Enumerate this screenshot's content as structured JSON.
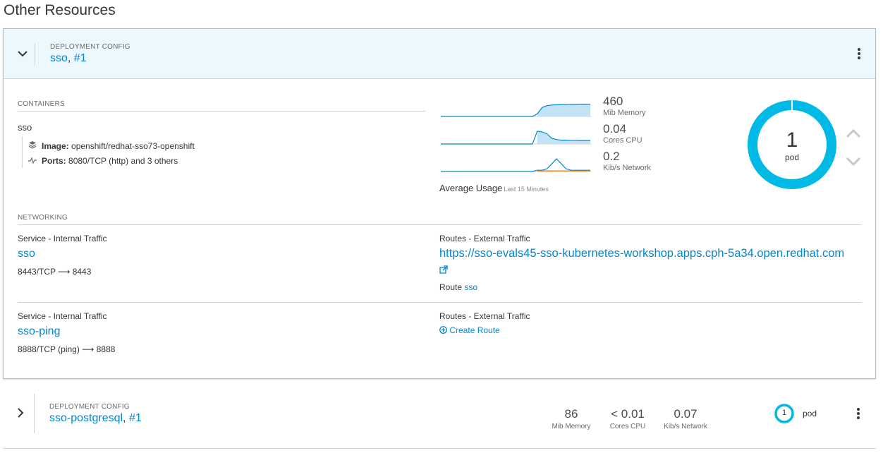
{
  "page": {
    "title": "Other Resources"
  },
  "resource1": {
    "kind": "Deployment Config",
    "name": "sso",
    "revision": "#1",
    "containers_title": "Containers",
    "container": {
      "name": "sso",
      "image_label": "Image:",
      "image_value": "openshift/redhat-sso73-openshift",
      "ports_label": "Ports:",
      "ports_value": "8080/TCP (http) and 3 others"
    },
    "metrics": [
      {
        "value": "460",
        "unit": "Mib Memory"
      },
      {
        "value": "0.04",
        "unit": "Cores CPU"
      },
      {
        "value": "0.2",
        "unit": "Kib/s Network"
      }
    ],
    "average_usage": "Average Usage",
    "average_period": "Last 15 Minutes",
    "pods": {
      "count": "1",
      "label": "pod"
    },
    "networking_title": "Networking",
    "services": [
      {
        "service_label": "Service - Internal Traffic",
        "service_name": "sso",
        "ports": "8443/TCP",
        "target": "8443",
        "routes_label": "Routes - External Traffic",
        "route_url": "https://sso-evals45-sso-kubernetes-workshop.apps.cph-5a34.open.redhat.com",
        "route_prefix": "Route",
        "route_name": "sso"
      },
      {
        "service_label": "Service - Internal Traffic",
        "service_name": "sso-ping",
        "ports": "8888/TCP (ping)",
        "target": "8888",
        "routes_label": "Routes - External Traffic",
        "create_route": "Create Route"
      }
    ]
  },
  "resource2": {
    "kind": "Deployment Config",
    "name": "sso-postgresql",
    "revision": "#1",
    "metrics": [
      {
        "value": "86",
        "unit": "Mib Memory"
      },
      {
        "value": "< 0.01",
        "unit": "Cores CPU"
      },
      {
        "value": "0.07",
        "unit": "Kib/s Network"
      }
    ],
    "pods": {
      "count": "1",
      "label": "pod"
    }
  },
  "colors": {
    "link": "#0088ce",
    "donut": "#00b9e4",
    "header_bg": "#edf8fe",
    "sparkline": "#0088ce",
    "sparkline_fill": "#c3e3f4",
    "network_alt": "#ec7a08"
  },
  "icons": [
    "chevron-down-icon",
    "chevron-right-icon",
    "kebab-icon",
    "layers-icon",
    "pulse-icon",
    "external-link-icon",
    "plus-circle-icon",
    "chevron-up-icon"
  ],
  "sparklines": {
    "memory": [
      0,
      0,
      0,
      0,
      0,
      0,
      0,
      0,
      0,
      0,
      0,
      0,
      0,
      0,
      0,
      0,
      0,
      0,
      0,
      0,
      0.2,
      0.7,
      0.85,
      0.9,
      0.92,
      0.93,
      0.94,
      0.95,
      0.95,
      0.96,
      0.96,
      0.96
    ],
    "cpu": [
      0,
      0,
      0,
      0,
      0,
      0,
      0,
      0,
      0,
      0,
      0,
      0,
      0,
      0,
      0,
      0,
      0,
      0,
      0,
      0,
      1.0,
      0.95,
      0.8,
      0.45,
      0.35,
      0.3,
      0.3,
      0.28,
      0.28,
      0.27,
      0.27,
      0.27
    ],
    "network_in": [
      0,
      0,
      0,
      0,
      0,
      0,
      0,
      0,
      0,
      0,
      0,
      0,
      0,
      0,
      0,
      0,
      0,
      0,
      0,
      0,
      0.1,
      0.1,
      0.2,
      0.6,
      1.0,
      0.6,
      0.2,
      0.1,
      0.1,
      0.1,
      0.1,
      0.1
    ],
    "network_out": [
      0,
      0,
      0,
      0,
      0,
      0,
      0,
      0,
      0,
      0,
      0,
      0,
      0,
      0,
      0,
      0,
      0,
      0,
      0,
      0,
      0.05,
      0.05,
      0.05,
      0.05,
      0.05,
      0.05,
      0.05,
      0.05,
      0.05,
      0.05,
      0.05,
      0.05
    ]
  }
}
